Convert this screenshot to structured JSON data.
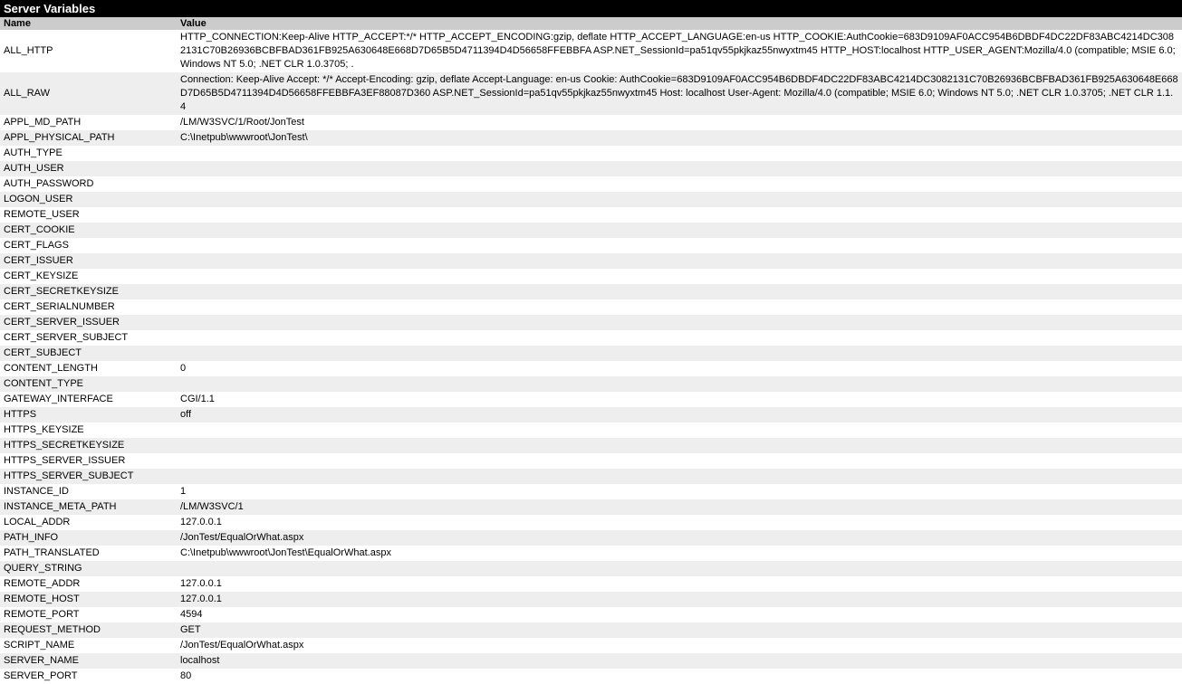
{
  "title": "Server Variables",
  "columns": {
    "name": "Name",
    "value": "Value"
  },
  "rows": [
    {
      "name": "ALL_HTTP",
      "value": "HTTP_CONNECTION:Keep-Alive HTTP_ACCEPT:*/* HTTP_ACCEPT_ENCODING:gzip, deflate HTTP_ACCEPT_LANGUAGE:en-us HTTP_COOKIE:AuthCookie=683D9109AF0ACC954B6DBDF4DC22DF83ABC4214DC3082131C70B26936BCBFBAD361FB925A630648E668D7D65B5D4711394D4D56658FFEBBFA ASP.NET_SessionId=pa51qv55pkjkaz55nwyxtm45 HTTP_HOST:localhost HTTP_USER_AGENT:Mozilla/4.0 (compatible; MSIE 6.0; Windows NT 5.0; .NET CLR 1.0.3705; ."
    },
    {
      "name": "ALL_RAW",
      "value": "Connection: Keep-Alive Accept: */* Accept-Encoding: gzip, deflate Accept-Language: en-us Cookie: AuthCookie=683D9109AF0ACC954B6DBDF4DC22DF83ABC4214DC3082131C70B26936BCBFBAD361FB925A630648E668D7D65B5D4711394D4D56658FFEBBFA3EF88087D360 ASP.NET_SessionId=pa51qv55pkjkaz55nwyxtm45 Host: localhost User-Agent: Mozilla/4.0 (compatible; MSIE 6.0; Windows NT 5.0; .NET CLR 1.0.3705; .NET CLR 1.1.4"
    },
    {
      "name": "APPL_MD_PATH",
      "value": "/LM/W3SVC/1/Root/JonTest"
    },
    {
      "name": "APPL_PHYSICAL_PATH",
      "value": "C:\\Inetpub\\wwwroot\\JonTest\\"
    },
    {
      "name": "AUTH_TYPE",
      "value": ""
    },
    {
      "name": "AUTH_USER",
      "value": ""
    },
    {
      "name": "AUTH_PASSWORD",
      "value": ""
    },
    {
      "name": "LOGON_USER",
      "value": ""
    },
    {
      "name": "REMOTE_USER",
      "value": ""
    },
    {
      "name": "CERT_COOKIE",
      "value": ""
    },
    {
      "name": "CERT_FLAGS",
      "value": ""
    },
    {
      "name": "CERT_ISSUER",
      "value": ""
    },
    {
      "name": "CERT_KEYSIZE",
      "value": ""
    },
    {
      "name": "CERT_SECRETKEYSIZE",
      "value": ""
    },
    {
      "name": "CERT_SERIALNUMBER",
      "value": ""
    },
    {
      "name": "CERT_SERVER_ISSUER",
      "value": ""
    },
    {
      "name": "CERT_SERVER_SUBJECT",
      "value": ""
    },
    {
      "name": "CERT_SUBJECT",
      "value": ""
    },
    {
      "name": "CONTENT_LENGTH",
      "value": "0"
    },
    {
      "name": "CONTENT_TYPE",
      "value": ""
    },
    {
      "name": "GATEWAY_INTERFACE",
      "value": "CGI/1.1"
    },
    {
      "name": "HTTPS",
      "value": "off"
    },
    {
      "name": "HTTPS_KEYSIZE",
      "value": ""
    },
    {
      "name": "HTTPS_SECRETKEYSIZE",
      "value": ""
    },
    {
      "name": "HTTPS_SERVER_ISSUER",
      "value": ""
    },
    {
      "name": "HTTPS_SERVER_SUBJECT",
      "value": ""
    },
    {
      "name": "INSTANCE_ID",
      "value": "1"
    },
    {
      "name": "INSTANCE_META_PATH",
      "value": "/LM/W3SVC/1"
    },
    {
      "name": "LOCAL_ADDR",
      "value": "127.0.0.1"
    },
    {
      "name": "PATH_INFO",
      "value": "/JonTest/EqualOrWhat.aspx"
    },
    {
      "name": "PATH_TRANSLATED",
      "value": "C:\\Inetpub\\wwwroot\\JonTest\\EqualOrWhat.aspx"
    },
    {
      "name": "QUERY_STRING",
      "value": ""
    },
    {
      "name": "REMOTE_ADDR",
      "value": "127.0.0.1"
    },
    {
      "name": "REMOTE_HOST",
      "value": "127.0.0.1"
    },
    {
      "name": "REMOTE_PORT",
      "value": "4594"
    },
    {
      "name": "REQUEST_METHOD",
      "value": "GET"
    },
    {
      "name": "SCRIPT_NAME",
      "value": "/JonTest/EqualOrWhat.aspx"
    },
    {
      "name": "SERVER_NAME",
      "value": "localhost"
    },
    {
      "name": "SERVER_PORT",
      "value": "80"
    }
  ]
}
